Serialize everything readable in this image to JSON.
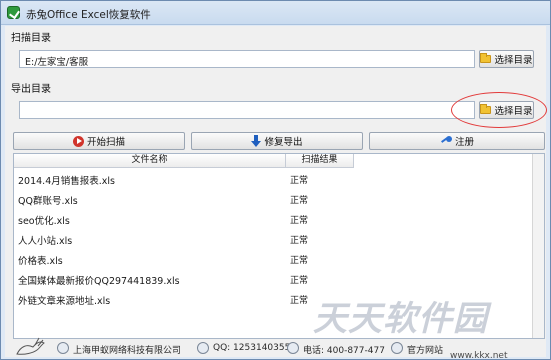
{
  "window": {
    "title": "赤兔Office Excel恢复软件"
  },
  "scan": {
    "label": "扫描目录",
    "path": "E:/左家宝/客服",
    "choose_btn": "选择目录"
  },
  "export": {
    "label": "导出目录",
    "path": "",
    "choose_btn": "选择目录"
  },
  "actions": {
    "start_scan": "开始扫描",
    "repair_export": "修复导出",
    "register": "注册"
  },
  "table": {
    "headers": [
      "文件名称",
      "扫描结果"
    ],
    "rows": [
      {
        "name": "2014.4月销售报表.xls",
        "result": "正常"
      },
      {
        "name": "QQ群账号.xls",
        "result": "正常"
      },
      {
        "name": "seo优化.xls",
        "result": "正常"
      },
      {
        "name": "人人小站.xls",
        "result": "正常"
      },
      {
        "name": "价格表.xls",
        "result": "正常"
      },
      {
        "name": "全国媒体最新报价QQ297441839.xls",
        "result": "正常"
      },
      {
        "name": "外链文章来源地址.xls",
        "result": "正常"
      }
    ]
  },
  "footer": {
    "company": "上海甲蚁网络科技有限公司",
    "qq": "QQ: 1253140355",
    "phone": "电话: 400-877-477",
    "extra": "官方网站"
  },
  "watermark": {
    "main": "天天软件园",
    "sub": "www.kkx.net"
  },
  "colors": {
    "window_bg": "#dfe9f5",
    "highlight_circle": "#e23b3b"
  }
}
